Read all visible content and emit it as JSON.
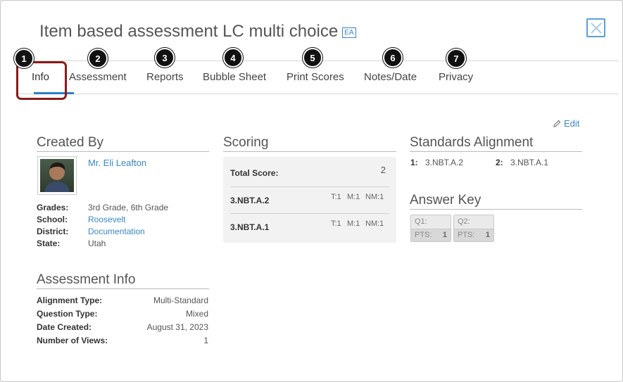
{
  "header": {
    "title": "Item based assessment LC multi choice",
    "badge": "EA"
  },
  "tabs": [
    {
      "label": "Info",
      "number": "1"
    },
    {
      "label": "Assessment",
      "number": "2"
    },
    {
      "label": "Reports",
      "number": "3"
    },
    {
      "label": "Bubble Sheet",
      "number": "4"
    },
    {
      "label": "Print Scores",
      "number": "5"
    },
    {
      "label": "Notes/Date",
      "number": "6"
    },
    {
      "label": "Privacy",
      "number": "7"
    }
  ],
  "active_tab": "Info",
  "edit_label": "Edit",
  "created_by": {
    "heading": "Created By",
    "name": "Mr. Eli Leafton",
    "grades_label": "Grades:",
    "grades": "3rd Grade, 6th Grade",
    "school_label": "School:",
    "school": "Roosevelt",
    "district_label": "District:",
    "district": "Documentation",
    "state_label": "State:",
    "state": "Utah"
  },
  "assessment_info": {
    "heading": "Assessment Info",
    "rows": [
      {
        "label": "Alignment Type:",
        "value": "Multi-Standard"
      },
      {
        "label": "Question Type:",
        "value": "Mixed"
      },
      {
        "label": "Date Created:",
        "value": "August 31, 2023"
      },
      {
        "label": "Number of Views:",
        "value": "1"
      }
    ]
  },
  "scoring": {
    "heading": "Scoring",
    "total_label": "Total Score:",
    "total_value": "2",
    "rows": [
      {
        "standard": "3.NBT.A.2",
        "t": "T:1",
        "m": "M:1",
        "nm": "NM:1"
      },
      {
        "standard": "3.NBT.A.1",
        "t": "T:1",
        "m": "M:1",
        "nm": "NM:1"
      }
    ]
  },
  "standards_alignment": {
    "heading": "Standards Alignment",
    "items": [
      {
        "num": "1:",
        "code": "3.NBT.A.2"
      },
      {
        "num": "2:",
        "code": "3.NBT.A.1"
      }
    ]
  },
  "answer_key": {
    "heading": "Answer Key",
    "items": [
      {
        "q": "Q1:",
        "pts_label": "PTS:",
        "pts": "1"
      },
      {
        "q": "Q2:",
        "pts_label": "PTS:",
        "pts": "1"
      }
    ]
  },
  "colors": {
    "accent": "#2a7fc9",
    "link": "#3a86c8",
    "highlight": "#8b1a1a"
  }
}
